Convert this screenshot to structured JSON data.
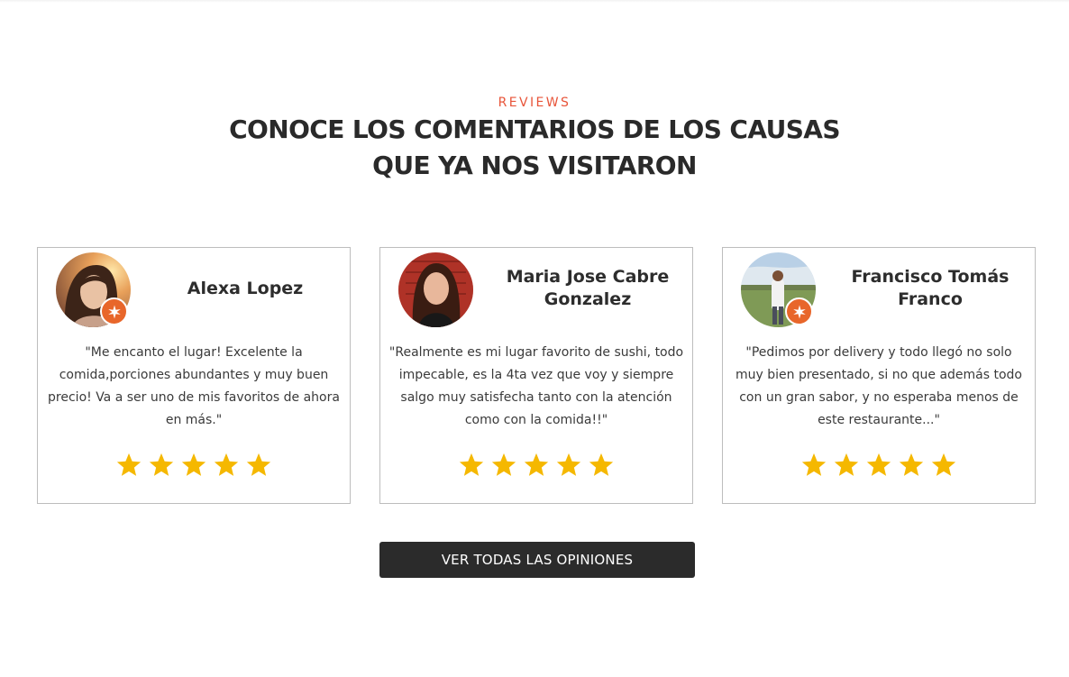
{
  "section": {
    "eyebrow": "REVIEWS",
    "title_line1": "CONOCE LOS COMENTARIOS DE LOS CAUSAS",
    "title_line2": "QUE YA NOS VISITARON"
  },
  "reviews": [
    {
      "name": "Alexa Lopez",
      "quote": "\"Me encanto el lugar! Excelente la comida,porciones abundantes y muy buen precio! Va a ser uno de mis favoritos de ahora en más.\"",
      "rating": 5,
      "avatar": "user-photo-avatar",
      "badge": "local-guide-badge-icon"
    },
    {
      "name": "Maria Jose Cabre Gonzalez",
      "quote": "\"Realmente es mi lugar favorito de sushi, todo impecable, es la 4ta vez que voy y siempre salgo muy satisfecha tanto con la atención como con la comida!!\"",
      "rating": 5,
      "avatar": "user-photo-avatar"
    },
    {
      "name": "Francisco Tomás Franco",
      "quote": "\"Pedimos por delivery y todo llegó no solo muy bien presentado, si no que además todo con un gran sabor, y no esperaba menos de este restaurante...\"",
      "rating": 5,
      "avatar": "user-photo-avatar",
      "badge": "local-guide-badge-icon"
    }
  ],
  "cta": {
    "label": "VER TODAS LAS OPINIONES"
  },
  "colors": {
    "accent": "#e8553a",
    "star": "#f5b800",
    "badge": "#e8662a",
    "button_bg": "#2b2b2b"
  }
}
